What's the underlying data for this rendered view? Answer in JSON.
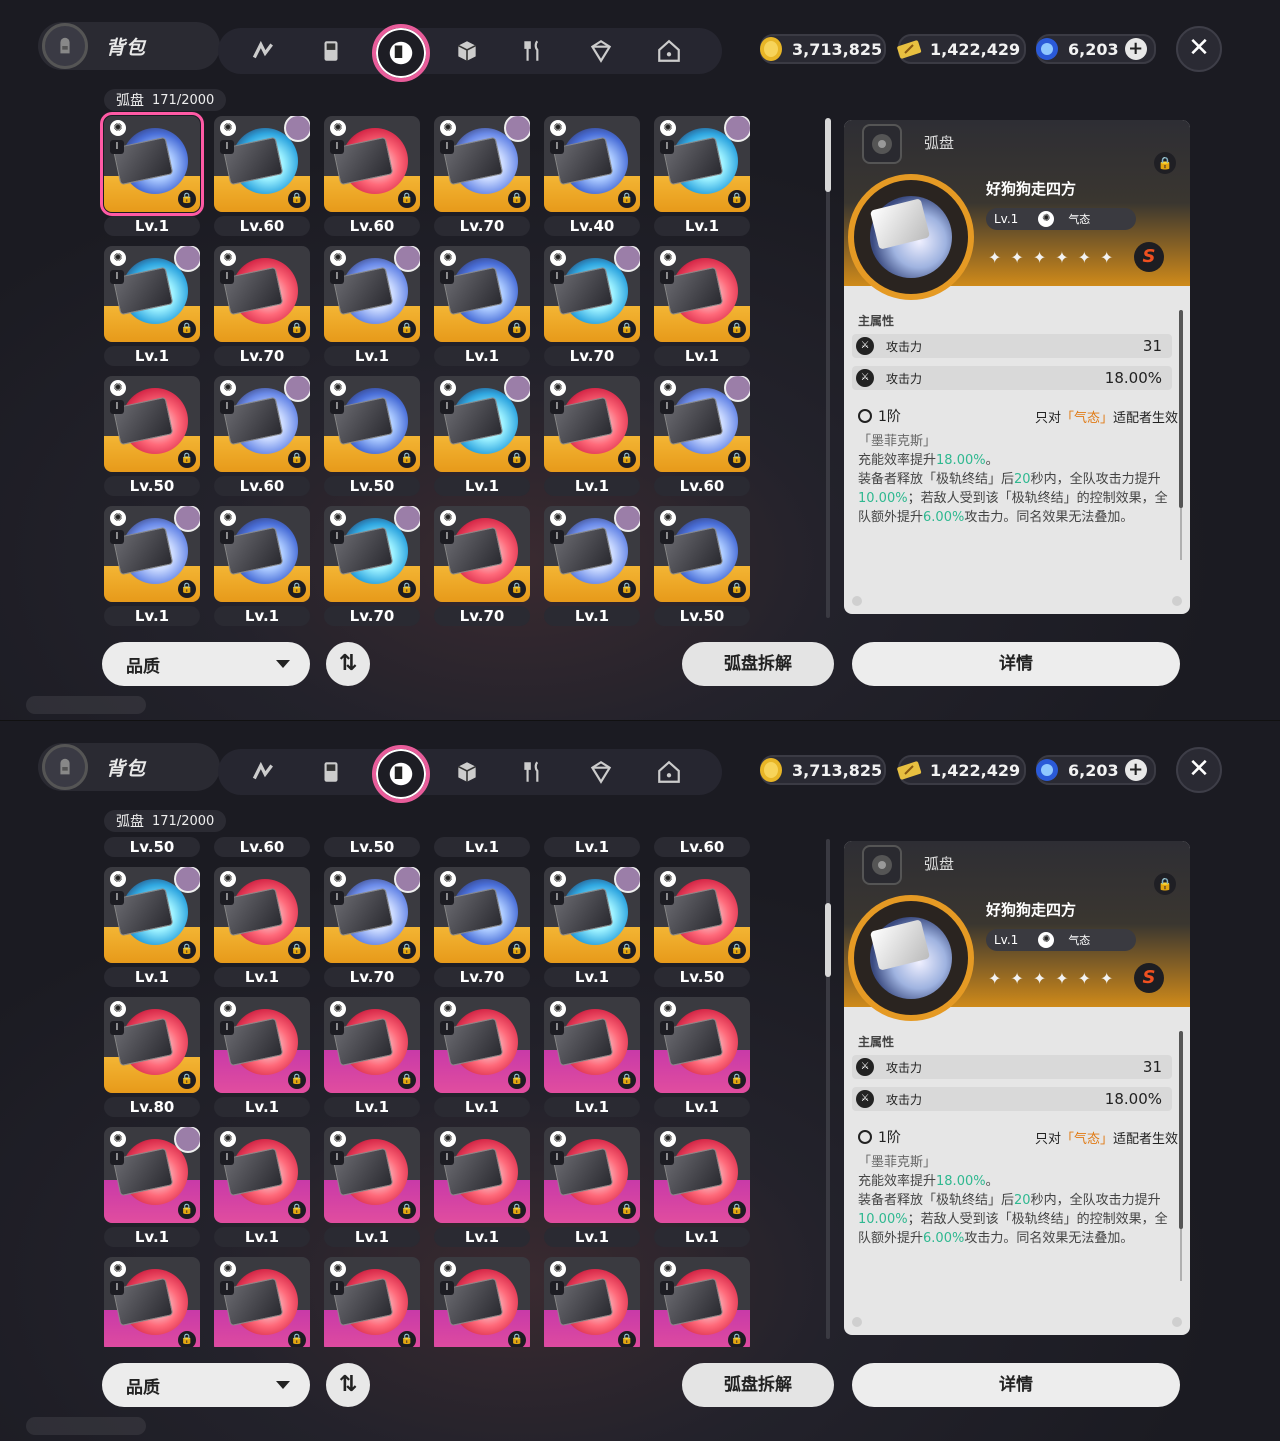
{
  "screens": [
    {
      "header": {
        "title": "背包"
      },
      "currencies": [
        {
          "icon": "gold-coin-icon",
          "value": "3,713,825"
        },
        {
          "icon": "ticket-icon",
          "value": "1,422,429"
        },
        {
          "icon": "crystal-icon",
          "value": "6,203"
        }
      ],
      "tabs": [
        "agent-icon",
        "console-icon",
        "disc-icon",
        "box-icon",
        "food-icon",
        "cube-icon",
        "home-icon"
      ],
      "inventory": {
        "category": "弧盘",
        "count": "171/2000"
      },
      "rows": [
        [
          "Lv.1",
          "Lv.60",
          "Lv.60",
          "Lv.70",
          "Lv.40",
          "Lv.1"
        ],
        [
          "Lv.1",
          "Lv.70",
          "Lv.1",
          "Lv.1",
          "Lv.70",
          "Lv.1"
        ],
        [
          "Lv.50",
          "Lv.60",
          "Lv.50",
          "Lv.1",
          "Lv.1",
          "Lv.60"
        ],
        [
          "Lv.1",
          "Lv.1",
          "Lv.70",
          "Lv.70",
          "Lv.1",
          "Lv.50"
        ]
      ],
      "bottom": {
        "quality": "品质",
        "dismantle": "弧盘拆解",
        "detail": "详情"
      }
    },
    {
      "header": {
        "title": "背包"
      },
      "currencies": [
        {
          "icon": "gold-coin-icon",
          "value": "3,713,825"
        },
        {
          "icon": "ticket-icon",
          "value": "1,422,429"
        },
        {
          "icon": "crystal-icon",
          "value": "6,203"
        }
      ],
      "inventory": {
        "category": "弧盘",
        "count": "171/2000"
      },
      "rows": [
        [
          "Lv.50",
          "Lv.60",
          "Lv.50",
          "Lv.1",
          "Lv.1",
          "Lv.60"
        ],
        [
          "Lv.1",
          "Lv.1",
          "Lv.70",
          "Lv.70",
          "Lv.1",
          "Lv.50"
        ],
        [
          "Lv.80",
          "Lv.1",
          "Lv.1",
          "Lv.1",
          "Lv.1",
          "Lv.1"
        ],
        [
          "Lv.1",
          "Lv.1",
          "Lv.1",
          "Lv.1",
          "Lv.1",
          "Lv.1"
        ],
        [
          "",
          "",
          "",
          "",
          "",
          ""
        ]
      ],
      "bottom": {
        "quality": "品质",
        "dismantle": "弧盘拆解",
        "detail": "详情"
      }
    }
  ],
  "detail": {
    "category": "弧盘",
    "name": "好狗狗走四方",
    "level": "Lv.1",
    "attribute": "气态",
    "rarity": "S",
    "main_attr_label": "主属性",
    "stats": [
      {
        "name": "攻击力",
        "value": "31"
      },
      {
        "name": "攻击力",
        "value": "18.00%"
      }
    ],
    "tier": "1阶",
    "only_prefix": "只对",
    "only_attr": "「气态」",
    "only_suffix": "适配者生效",
    "desc_name": "「墨菲克斯」",
    "desc_l1a": "充能效率提升",
    "desc_l1b": "18.00%",
    "desc_l1c": "。",
    "desc_l2a": "装备者释放「极轨终结」后",
    "desc_l2b": "20",
    "desc_l2c": "秒内，全队攻击力提升",
    "desc_l2d": "10.00%",
    "desc_l2e": "；若敌人受到该「极轨终结」的控制效果，全队额外提升",
    "desc_l2f": "6.00%",
    "desc_l2g": "攻击力。同名效果无法叠加。"
  },
  "colors": {
    "accent": "#e85c9a",
    "gold": "#f3b534",
    "purple": "#d54aa5",
    "green": "#2fb890",
    "orange": "#e07a14"
  }
}
